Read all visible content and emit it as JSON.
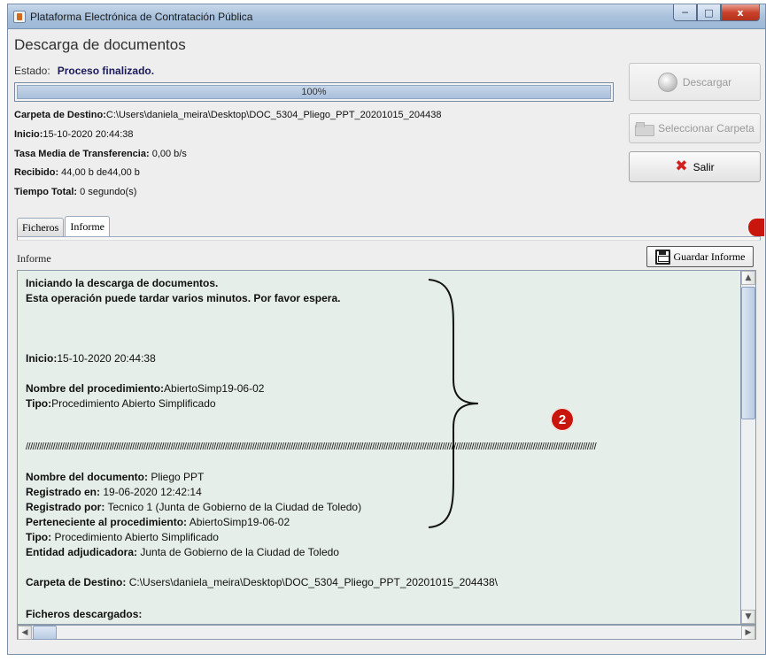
{
  "window": {
    "title": "Plataforma Electrónica de Contratación Pública",
    "minimize": "─",
    "maximize": "□",
    "close": "x"
  },
  "header": {
    "title": "Descarga de documentos",
    "estado_label": "Estado:",
    "estado_value": "Proceso finalizado."
  },
  "progress": {
    "value": 100,
    "text": "100%"
  },
  "info": {
    "carpeta_label": "Carpeta de Destino:",
    "carpeta_value": "C:\\Users\\daniela_meira\\Desktop\\DOC_5304_Pliego_PPT_20201015_204438",
    "inicio_label": "Inicio:",
    "inicio_value": "15-10-2020 20:44:38",
    "tasa_label": "Tasa Media de Transferencia:",
    "tasa_value": " 0,00 b/s",
    "recibido_label": "Recibido:",
    "recibido_value": " 44,00 b de44,00 b",
    "tiempo_label": "Tiempo Total:",
    "tiempo_value": " 0 segundo(s)"
  },
  "buttons": {
    "descargar": "Descargar",
    "seleccionar": "Seleccionar Carpeta",
    "salir": "Salir",
    "guardar": "Guardar Informe"
  },
  "tabs": [
    {
      "label": "Ficheros",
      "active": false
    },
    {
      "label": "Informe",
      "active": true
    }
  ],
  "report": {
    "label": "Informe",
    "line1": "Iniciando la descarga de documentos.",
    "line2": "Esta operación puede tardar varios minutos. Por favor espera.",
    "inicio_label": "Inicio:",
    "inicio_value": "15-10-2020 20:44:38",
    "nombre_proc_label": "Nombre del procedimiento:",
    "nombre_proc_value": "AbiertoSimp19-06-02",
    "tipo_label": "Tipo:",
    "tipo_value": "Procedimiento Abierto Simplificado",
    "separator": "////////////////////////////////////////////////////////////////////////////////////////////////////////////////////////////////////////////////////////////////////////////////////////////////////////////////////////////////////////////////////////////",
    "nombre_doc_label": "Nombre del documento:",
    "nombre_doc_value": " Pliego PPT",
    "registrado_en_label": "Registrado en:",
    "registrado_en_value": " 19-06-2020 12:42:14",
    "registrado_por_label": "Registrado por:",
    "registrado_por_value": " Tecnico 1 (Junta de Gobierno de la Ciudad de Toledo)",
    "perteneciente_label": "Perteneciente al procedimiento:",
    "perteneciente_value": " AbiertoSimp19-06-02",
    "tipo2_label": "Tipo:",
    "tipo2_value": " Procedimiento Abierto Simplificado",
    "entidad_label": "Entidad adjudicadora:",
    "entidad_value": " Junta de Gobierno de la Ciudad de Toledo",
    "carpeta_label": "Carpeta de Destino:",
    "carpeta_value": " C:\\Users\\daniela_meira\\Desktop\\DOC_5304_Pliego_PPT_20201015_204438\\",
    "ficheros_label": "Ficheros descargados:"
  },
  "annotations": {
    "badge_number": "2",
    "color": "#c9160c"
  }
}
